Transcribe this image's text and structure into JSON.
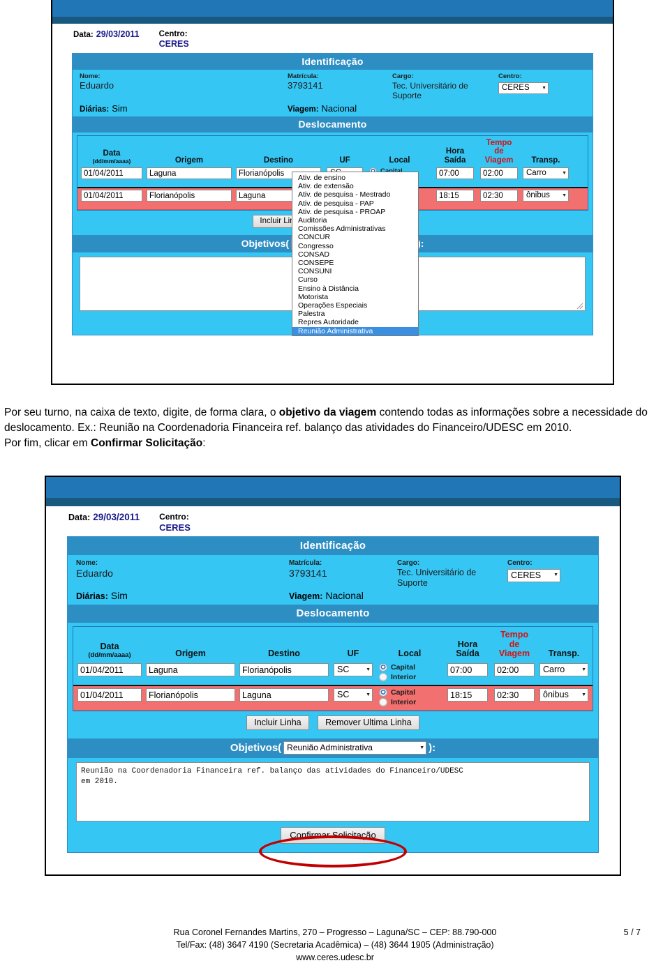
{
  "form": {
    "meta": {
      "data_label": "Data:",
      "data_value": "29/03/2011",
      "centro_label": "Centro:",
      "centro_value": "CERES"
    },
    "identificacao": {
      "band": "Identificação",
      "nome_label": "Nome:",
      "nome_value": "Eduardo",
      "matricula_label": "Matrícula:",
      "matricula_value": "3793141",
      "cargo_label": "Cargo:",
      "cargo_value": "Tec. Universitário de Suporte",
      "centro_label": "Centro:",
      "centro_select": "CERES",
      "diarias_label": "Diárias:",
      "diarias_value": "Sim",
      "viagem_label": "Viagem:",
      "viagem_value": "Nacional"
    },
    "deslocamento": {
      "band": "Deslocamento",
      "headers": {
        "data": "Data",
        "data_sub": "(dd/mm/aaaa)",
        "origem": "Origem",
        "destino": "Destino",
        "uf": "UF",
        "local": "Local",
        "hora_saida_l1": "Hora",
        "hora_saida_l2": "Saída",
        "tempo_l1": "Tempo",
        "tempo_l2": "de",
        "tempo_l3": "Viagem",
        "transp": "Transp."
      },
      "rows": [
        {
          "data": "01/04/2011",
          "origem": "Laguna",
          "destino": "Florianópolis",
          "uf": "SC",
          "local_capital": "Capital",
          "local_interior": "Interior",
          "local_selected": "Capital",
          "hora_saida": "07:00",
          "tempo_viagem": "02:00",
          "transp": "Carro"
        },
        {
          "data": "01/04/2011",
          "origem": "Florianópolis",
          "destino": "Laguna",
          "uf": "SC",
          "local_capital": "Capital",
          "local_interior": "Interior",
          "local_selected": "Capital",
          "hora_saida": "18:15",
          "tempo_viagem": "02:30",
          "transp": "ônibus"
        }
      ],
      "btn_incluir": "Incluir Linha",
      "btn_remover": "Remover Ultima Linha"
    },
    "objetivos": {
      "label_prefix": "Objetivos(",
      "label_suffix": "):",
      "select_empty": "",
      "select_chosen": "Reunião Administrativa",
      "textarea_empty": "",
      "textarea_filled": "Reunião na Coordenadoria Financeira ref. balanço das atividades do Financeiro/UDESC\nem 2010.",
      "options": [
        "Ativ. de ensino",
        "Ativ. de extensão",
        "Ativ. de pesquisa - Mestrado",
        "Ativ. de pesquisa - PAP",
        "Ativ. de pesquisa - PROAP",
        "Auditoria",
        "Comissões Administrativas",
        "CONCUR",
        "Congresso",
        "CONSAD",
        "CONSEPE",
        "CONSUNI",
        "Curso",
        "Ensino à Distância",
        "Motorista",
        "Operações Especiais",
        "Palestra",
        "Repres Autoridade",
        "Reunião Administrativa"
      ],
      "selected_option": "Reunião Administrativa"
    },
    "confirm_button": "Confirmar Solicitação"
  },
  "instructions": {
    "p1_a": "Por seu turno, na caixa de texto, digite, de forma clara, o ",
    "p1_b": "objetivo da viagem",
    "p1_c": " contendo todas as informações sobre a necessidade do deslocamento. Ex.: Reunião na Coordenadoria Financeira ref. balanço das atividades do Financeiro/UDESC em 2010.",
    "p2_a": "Por fim, clicar em ",
    "p2_b": "Confirmar Solicitação",
    "p2_c": ":"
  },
  "footer": {
    "line1": "Rua Coronel Fernandes Martins, 270 – Progresso – Laguna/SC – CEP: 88.790-000",
    "line2": "Tel/Fax: (48) 3647 4190 (Secretaria Acadêmica) – (48) 3644 1905 (Administração)",
    "line3": "www.ceres.udesc.br",
    "page": "5 / 7"
  },
  "colors": {
    "browser_blue": "#2176b6",
    "browser_strip": "#19587f",
    "band_blue": "#2d8ec4",
    "panel_cyan": "#35c6f4",
    "row_red": "#f2706f",
    "highlight_red": "#c00000",
    "value_navy": "#1a1a8c",
    "tempo_red": "#d81010",
    "option_select_blue": "#3b8fe0"
  }
}
